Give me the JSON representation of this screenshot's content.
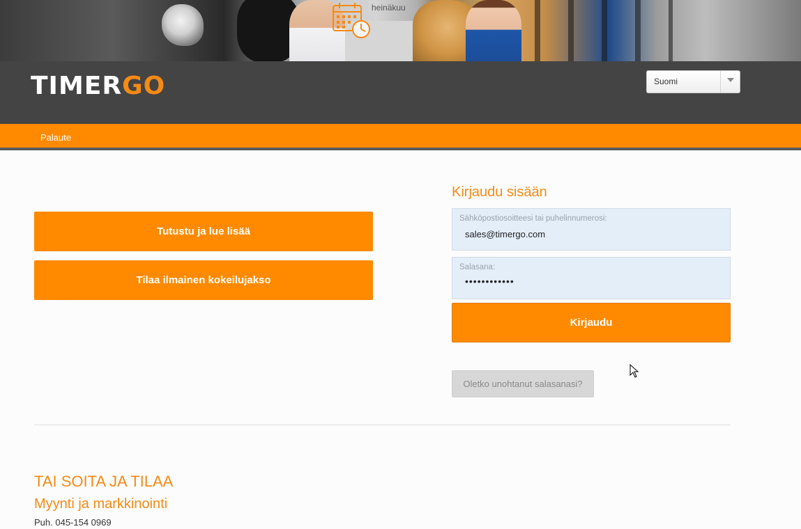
{
  "banner": {
    "month_text": "heinäkuu",
    "icons": [
      "calendar-clock-icon"
    ]
  },
  "header": {
    "logo_part1": "TIMER",
    "logo_part2": "GO",
    "language_select": {
      "selected": "Suomi"
    }
  },
  "nav": {
    "items": [
      "Palaute"
    ]
  },
  "actions": {
    "learn_more": "Tutustu ja lue lisää",
    "free_trial": "Tilaa ilmainen kokeilujakso"
  },
  "login": {
    "title": "Kirjaudu sisään",
    "email_label": "Sähköpostiosoitteesi tai puhelinnumerosi:",
    "email_value": "sales@timergo.com",
    "password_label": "Salasana:",
    "password_value": "••••••••••••",
    "submit_label": "Kirjaudu",
    "forgot_label": "Oletko unohtanut salasanasi?"
  },
  "contact": {
    "title": "TAI SOITA JA TILAA",
    "subtitle": "Myynti ja markkinointi",
    "phone": "Puh. 045-154 0969"
  },
  "colors": {
    "accent": "#ff8a00",
    "header_bg": "#444444",
    "field_bg": "#e4eef9"
  }
}
